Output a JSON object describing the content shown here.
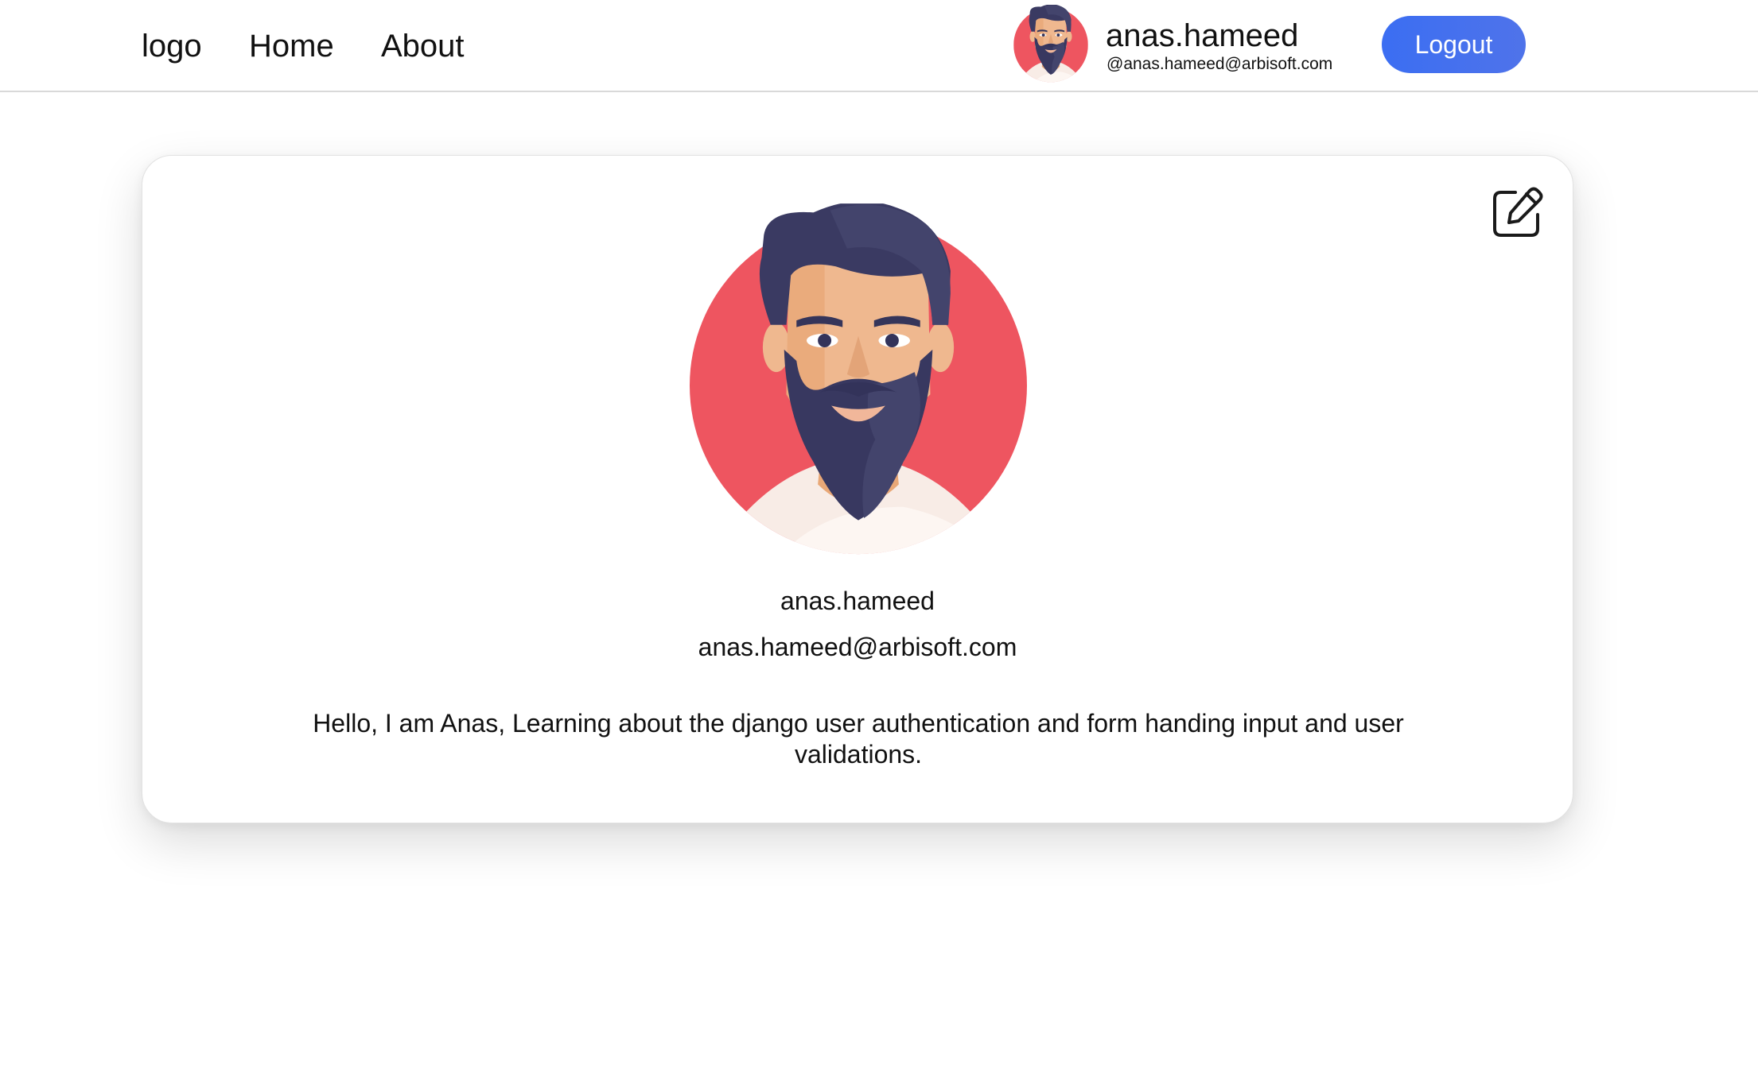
{
  "nav": {
    "logo": "logo",
    "links": [
      "Home",
      "About"
    ],
    "user": {
      "username": "anas.hameed",
      "email": "@anas.hameed@arbisoft.com",
      "avatar_icon": "bearded-man-avatar-icon"
    },
    "logout_label": "Logout"
  },
  "profile": {
    "edit_icon": "edit-icon",
    "avatar_icon": "bearded-man-avatar-icon",
    "username": "anas.hameed",
    "email": "anas.hameed@arbisoft.com",
    "bio": "Hello, I am Anas, Learning about the django user authentication and form handing input and user validations."
  },
  "colors": {
    "accent": "#3b6ef2",
    "avatar_bg": "#ee5560",
    "hair": "#3a3a62",
    "skin": "#efb88f"
  }
}
